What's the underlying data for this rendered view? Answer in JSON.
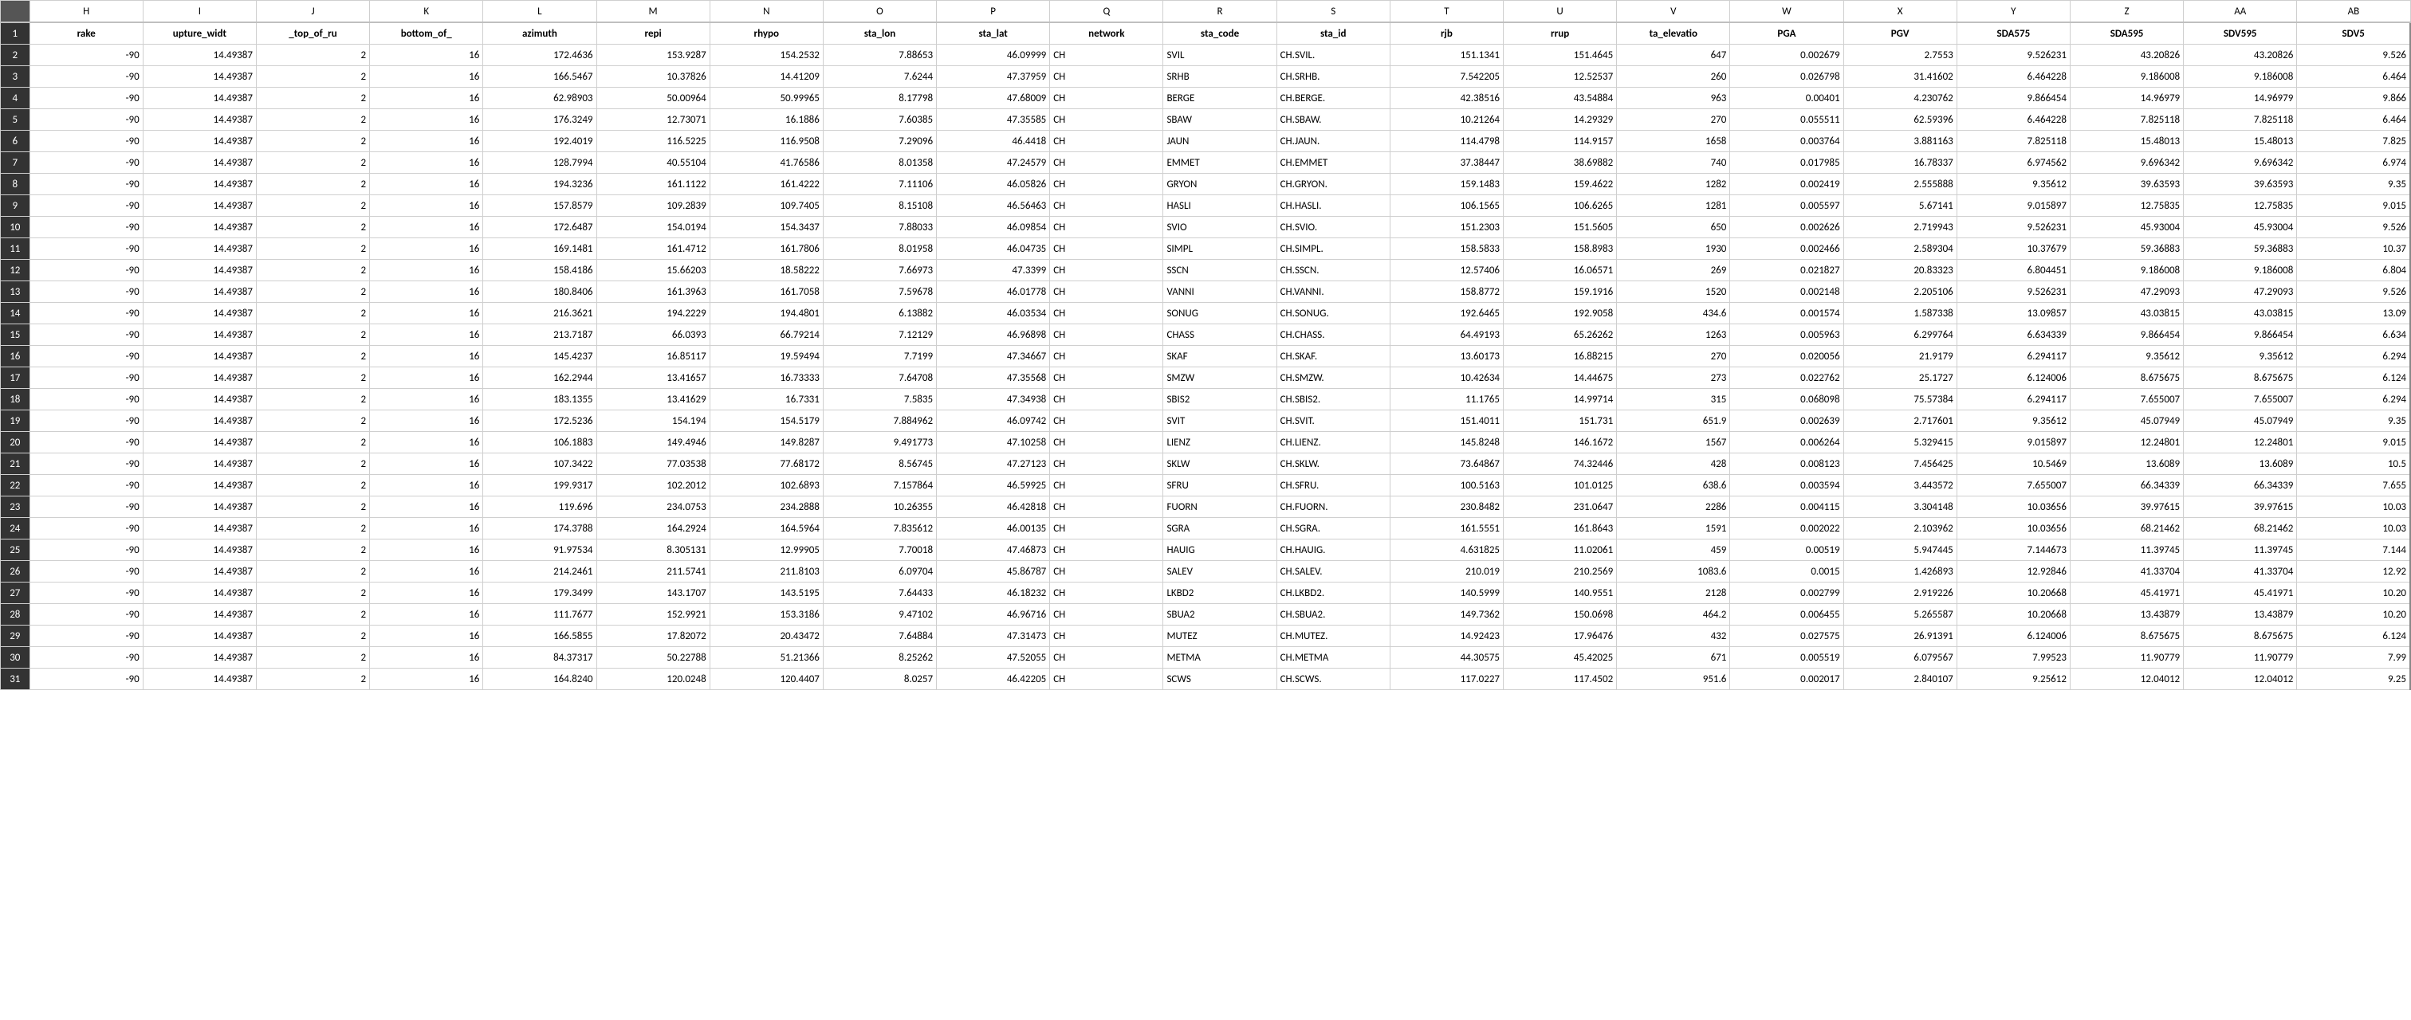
{
  "chart_data": {
    "type": "table",
    "title": "",
    "columns": [
      "H",
      "I",
      "J",
      "K",
      "L",
      "M",
      "N",
      "O",
      "P",
      "Q",
      "R",
      "S",
      "T",
      "U",
      "V",
      "W",
      "X",
      "Y",
      "Z",
      "AA",
      "AB"
    ],
    "rows": [
      "1",
      "2",
      "3",
      "4",
      "5",
      "6",
      "7",
      "8",
      "9",
      "10",
      "11",
      "12",
      "13",
      "14",
      "15",
      "16",
      "17",
      "18",
      "19",
      "20",
      "21",
      "22",
      "23",
      "24",
      "25",
      "26",
      "27",
      "28",
      "29",
      "30",
      "31"
    ],
    "headers": [
      "rake",
      "upture_widt",
      "_top_of_ru",
      "bottom_of_",
      "azimuth",
      "repi",
      "rhypo",
      "sta_lon",
      "sta_lat",
      "network",
      "sta_code",
      "sta_id",
      "rjb",
      "rrup",
      "ta_elevatio",
      "PGA",
      "PGV",
      "SDA575",
      "SDA595",
      "SDV595",
      "SDV5"
    ],
    "data": [
      [
        "-90",
        "14.49387",
        "2",
        "16",
        "172.4636",
        "153.9287",
        "154.2532",
        "7.88653",
        "46.09999",
        "CH",
        "SVIL",
        "CH.SVIL.",
        "151.1341",
        "151.4645",
        "647",
        "0.002679",
        "2.7553",
        "9.526231",
        "43.20826",
        "43.20826",
        "9.526"
      ],
      [
        "-90",
        "14.49387",
        "2",
        "16",
        "166.5467",
        "10.37826",
        "14.41209",
        "7.6244",
        "47.37959",
        "CH",
        "SRHB",
        "CH.SRHB.",
        "7.542205",
        "12.52537",
        "260",
        "0.026798",
        "31.41602",
        "6.464228",
        "9.186008",
        "9.186008",
        "6.464"
      ],
      [
        "-90",
        "14.49387",
        "2",
        "16",
        "62.98903",
        "50.00964",
        "50.99965",
        "8.17798",
        "47.68009",
        "CH",
        "BERGE",
        "CH.BERGE.",
        "42.38516",
        "43.54884",
        "963",
        "0.00401",
        "4.230762",
        "9.866454",
        "14.96979",
        "14.96979",
        "9.866"
      ],
      [
        "-90",
        "14.49387",
        "2",
        "16",
        "176.3249",
        "12.73071",
        "16.1886",
        "7.60385",
        "47.35585",
        "CH",
        "SBAW",
        "CH.SBAW.",
        "10.21264",
        "14.29329",
        "270",
        "0.055511",
        "62.59396",
        "6.464228",
        "7.825118",
        "7.825118",
        "6.464"
      ],
      [
        "-90",
        "14.49387",
        "2",
        "16",
        "192.4019",
        "116.5225",
        "116.9508",
        "7.29096",
        "46.4418",
        "CH",
        "JAUN",
        "CH.JAUN.",
        "114.4798",
        "114.9157",
        "1658",
        "0.003764",
        "3.881163",
        "7.825118",
        "15.48013",
        "15.48013",
        "7.825"
      ],
      [
        "-90",
        "14.49387",
        "2",
        "16",
        "128.7994",
        "40.55104",
        "41.76586",
        "8.01358",
        "47.24579",
        "CH",
        "EMMET",
        "CH.EMMET",
        "37.38447",
        "38.69882",
        "740",
        "0.017985",
        "16.78337",
        "6.974562",
        "9.696342",
        "9.696342",
        "6.974"
      ],
      [
        "-90",
        "14.49387",
        "2",
        "16",
        "194.3236",
        "161.1122",
        "161.4222",
        "7.11106",
        "46.05826",
        "CH",
        "GRYON",
        "CH.GRYON.",
        "159.1483",
        "159.4622",
        "1282",
        "0.002419",
        "2.555888",
        "9.35612",
        "39.63593",
        "39.63593",
        "9.35"
      ],
      [
        "-90",
        "14.49387",
        "2",
        "16",
        "157.8579",
        "109.2839",
        "109.7405",
        "8.15108",
        "46.56463",
        "CH",
        "HASLI",
        "CH.HASLI.",
        "106.1565",
        "106.6265",
        "1281",
        "0.005597",
        "5.67141",
        "9.015897",
        "12.75835",
        "12.75835",
        "9.015"
      ],
      [
        "-90",
        "14.49387",
        "2",
        "16",
        "172.6487",
        "154.0194",
        "154.3437",
        "7.88033",
        "46.09854",
        "CH",
        "SVIO",
        "CH.SVIO.",
        "151.2303",
        "151.5605",
        "650",
        "0.002626",
        "2.719943",
        "9.526231",
        "45.93004",
        "45.93004",
        "9.526"
      ],
      [
        "-90",
        "14.49387",
        "2",
        "16",
        "169.1481",
        "161.4712",
        "161.7806",
        "8.01958",
        "46.04735",
        "CH",
        "SIMPL",
        "CH.SIMPL.",
        "158.5833",
        "158.8983",
        "1930",
        "0.002466",
        "2.589304",
        "10.37679",
        "59.36883",
        "59.36883",
        "10.37"
      ],
      [
        "-90",
        "14.49387",
        "2",
        "16",
        "158.4186",
        "15.66203",
        "18.58222",
        "7.66973",
        "47.3399",
        "CH",
        "SSCN",
        "CH.SSCN.",
        "12.57406",
        "16.06571",
        "269",
        "0.021827",
        "20.83323",
        "6.804451",
        "9.186008",
        "9.186008",
        "6.804"
      ],
      [
        "-90",
        "14.49387",
        "2",
        "16",
        "180.8406",
        "161.3963",
        "161.7058",
        "7.59678",
        "46.01778",
        "CH",
        "VANNI",
        "CH.VANNI.",
        "158.8772",
        "159.1916",
        "1520",
        "0.002148",
        "2.205106",
        "9.526231",
        "47.29093",
        "47.29093",
        "9.526"
      ],
      [
        "-90",
        "14.49387",
        "2",
        "16",
        "216.3621",
        "194.2229",
        "194.4801",
        "6.13882",
        "46.03534",
        "CH",
        "SONUG",
        "CH.SONUG.",
        "192.6465",
        "192.9058",
        "434.6",
        "0.001574",
        "1.587338",
        "13.09857",
        "43.03815",
        "43.03815",
        "13.09"
      ],
      [
        "-90",
        "14.49387",
        "2",
        "16",
        "213.7187",
        "66.0393",
        "66.79214",
        "7.12129",
        "46.96898",
        "CH",
        "CHASS",
        "CH.CHASS.",
        "64.49193",
        "65.26262",
        "1263",
        "0.005963",
        "6.299764",
        "6.634339",
        "9.866454",
        "9.866454",
        "6.634"
      ],
      [
        "-90",
        "14.49387",
        "2",
        "16",
        "145.4237",
        "16.85117",
        "19.59494",
        "7.7199",
        "47.34667",
        "CH",
        "SKAF",
        "CH.SKAF.",
        "13.60173",
        "16.88215",
        "270",
        "0.020056",
        "21.9179",
        "6.294117",
        "9.35612",
        "9.35612",
        "6.294"
      ],
      [
        "-90",
        "14.49387",
        "2",
        "16",
        "162.2944",
        "13.41657",
        "16.73333",
        "7.64708",
        "47.35568",
        "CH",
        "SMZW",
        "CH.SMZW.",
        "10.42634",
        "14.44675",
        "273",
        "0.022762",
        "25.1727",
        "6.124006",
        "8.675675",
        "8.675675",
        "6.124"
      ],
      [
        "-90",
        "14.49387",
        "2",
        "16",
        "183.1355",
        "13.41629",
        "16.7331",
        "7.5835",
        "47.34938",
        "CH",
        "SBIS2",
        "CH.SBIS2.",
        "11.1765",
        "14.99714",
        "315",
        "0.068098",
        "75.57384",
        "6.294117",
        "7.655007",
        "7.655007",
        "6.294"
      ],
      [
        "-90",
        "14.49387",
        "2",
        "16",
        "172.5236",
        "154.194",
        "154.5179",
        "7.884962",
        "46.09742",
        "CH",
        "SVIT",
        "CH.SVIT.",
        "151.4011",
        "151.731",
        "651.9",
        "0.002639",
        "2.717601",
        "9.35612",
        "45.07949",
        "45.07949",
        "9.35"
      ],
      [
        "-90",
        "14.49387",
        "2",
        "16",
        "106.1883",
        "149.4946",
        "149.8287",
        "9.491773",
        "47.10258",
        "CH",
        "LIENZ",
        "CH.LIENZ.",
        "145.8248",
        "146.1672",
        "1567",
        "0.006264",
        "5.329415",
        "9.015897",
        "12.24801",
        "12.24801",
        "9.015"
      ],
      [
        "-90",
        "14.49387",
        "2",
        "16",
        "107.3422",
        "77.03538",
        "77.68172",
        "8.56745",
        "47.27123",
        "CH",
        "SKLW",
        "CH.SKLW.",
        "73.64867",
        "74.32446",
        "428",
        "0.008123",
        "7.456425",
        "10.5469",
        "13.6089",
        "13.6089",
        "10.5"
      ],
      [
        "-90",
        "14.49387",
        "2",
        "16",
        "199.9317",
        "102.2012",
        "102.6893",
        "7.157864",
        "46.59925",
        "CH",
        "SFRU",
        "CH.SFRU.",
        "100.5163",
        "101.0125",
        "638.6",
        "0.003594",
        "3.443572",
        "7.655007",
        "66.34339",
        "66.34339",
        "7.655"
      ],
      [
        "-90",
        "14.49387",
        "2",
        "16",
        "119.696",
        "234.0753",
        "234.2888",
        "10.26355",
        "46.42818",
        "CH",
        "FUORN",
        "CH.FUORN.",
        "230.8482",
        "231.0647",
        "2286",
        "0.004115",
        "3.304148",
        "10.03656",
        "39.97615",
        "39.97615",
        "10.03"
      ],
      [
        "-90",
        "14.49387",
        "2",
        "16",
        "174.3788",
        "164.2924",
        "164.5964",
        "7.835612",
        "46.00135",
        "CH",
        "SGRA",
        "CH.SGRA.",
        "161.5551",
        "161.8643",
        "1591",
        "0.002022",
        "2.103962",
        "10.03656",
        "68.21462",
        "68.21462",
        "10.03"
      ],
      [
        "-90",
        "14.49387",
        "2",
        "16",
        "91.97534",
        "8.305131",
        "12.99905",
        "7.70018",
        "47.46873",
        "CH",
        "HAUIG",
        "CH.HAUIG.",
        "4.631825",
        "11.02061",
        "459",
        "0.00519",
        "5.947445",
        "7.144673",
        "11.39745",
        "11.39745",
        "7.144"
      ],
      [
        "-90",
        "14.49387",
        "2",
        "16",
        "214.2461",
        "211.5741",
        "211.8103",
        "6.09704",
        "45.86787",
        "CH",
        "SALEV",
        "CH.SALEV.",
        "210.019",
        "210.2569",
        "1083.6",
        "0.0015",
        "1.426893",
        "12.92846",
        "41.33704",
        "41.33704",
        "12.92"
      ],
      [
        "-90",
        "14.49387",
        "2",
        "16",
        "179.3499",
        "143.1707",
        "143.5195",
        "7.64433",
        "46.18232",
        "CH",
        "LKBD2",
        "CH.LKBD2.",
        "140.5999",
        "140.9551",
        "2128",
        "0.002799",
        "2.919226",
        "10.20668",
        "45.41971",
        "45.41971",
        "10.20"
      ],
      [
        "-90",
        "14.49387",
        "2",
        "16",
        "111.7677",
        "152.9921",
        "153.3186",
        "9.47102",
        "46.96716",
        "CH",
        "SBUA2",
        "CH.SBUA2.",
        "149.7362",
        "150.0698",
        "464.2",
        "0.006455",
        "5.265587",
        "10.20668",
        "13.43879",
        "13.43879",
        "10.20"
      ],
      [
        "-90",
        "14.49387",
        "2",
        "16",
        "166.5855",
        "17.82072",
        "20.43472",
        "7.64884",
        "47.31473",
        "CH",
        "MUTEZ",
        "CH.MUTEZ.",
        "14.92423",
        "17.96476",
        "432",
        "0.027575",
        "26.91391",
        "6.124006",
        "8.675675",
        "8.675675",
        "6.124"
      ],
      [
        "-90",
        "14.49387",
        "2",
        "16",
        "84.37317",
        "50.22788",
        "51.21366",
        "8.25262",
        "47.52055",
        "CH",
        "METMA",
        "CH.METMA",
        "44.30575",
        "45.42025",
        "671",
        "0.005519",
        "6.079567",
        "7.99523",
        "11.90779",
        "11.90779",
        "7.99"
      ],
      [
        "-90",
        "14.49387",
        "2",
        "16",
        "164.8240",
        "120.0248",
        "120.4407",
        "8.0257",
        "46.42205",
        "CH",
        "SCWS",
        "CH.SCWS.",
        "117.0227",
        "117.4502",
        "951.6",
        "0.002017",
        "2.840107",
        "9.25612",
        "12.04012",
        "12.04012",
        "9.25"
      ]
    ]
  },
  "textCols": [
    9,
    10,
    11
  ],
  "selectedRow": "1"
}
